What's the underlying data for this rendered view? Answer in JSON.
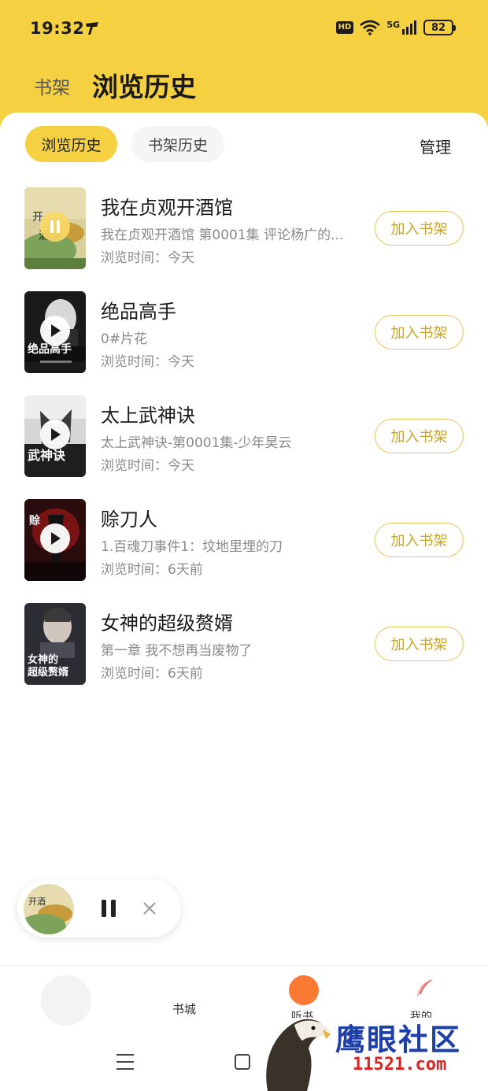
{
  "status_bar": {
    "time": "19:32",
    "hd_badge": "HD",
    "network": "5G",
    "battery": "82"
  },
  "header": {
    "shelf_tab": "书架",
    "title": "浏览历史"
  },
  "segments": {
    "browse": "浏览历史",
    "shelf": "书架历史",
    "manage": "管理"
  },
  "items": [
    {
      "title": "我在贞观开酒馆",
      "subtitle": "我在贞观开酒馆 第0001集 评论杨广的...",
      "time_label": "浏览时间：",
      "time": "今天",
      "button": "加入书架",
      "state": "playing"
    },
    {
      "title": "绝品高手",
      "subtitle": "0#片花",
      "time_label": "浏览时间：",
      "time": "今天",
      "button": "加入书架",
      "state": "paused"
    },
    {
      "title": "太上武神诀",
      "subtitle": "太上武神诀-第0001集-少年昊云",
      "time_label": "浏览时间：",
      "time": "今天",
      "button": "加入书架",
      "state": "paused"
    },
    {
      "title": "赊刀人",
      "subtitle": "1.百魂刀事件1：坟地里埋的刀",
      "time_label": "浏览时间：",
      "time": "6天前",
      "button": "加入书架",
      "state": "paused"
    },
    {
      "title": "女神的超级赘婿",
      "subtitle": "第一章 我不想再当废物了",
      "time_label": "浏览时间：",
      "time": "6天前",
      "button": "加入书架",
      "state": "none"
    }
  ],
  "bottom_nav": {
    "store": "书城",
    "center": "听书",
    "mine": "我的"
  },
  "watermark": {
    "title": "鹰眼社区",
    "url": "11521.com"
  },
  "colors": {
    "accent": "#f5d142",
    "button_text": "#c9a42b",
    "muted_text": "#8a8a8a",
    "center_nav": "#fa7a34"
  }
}
